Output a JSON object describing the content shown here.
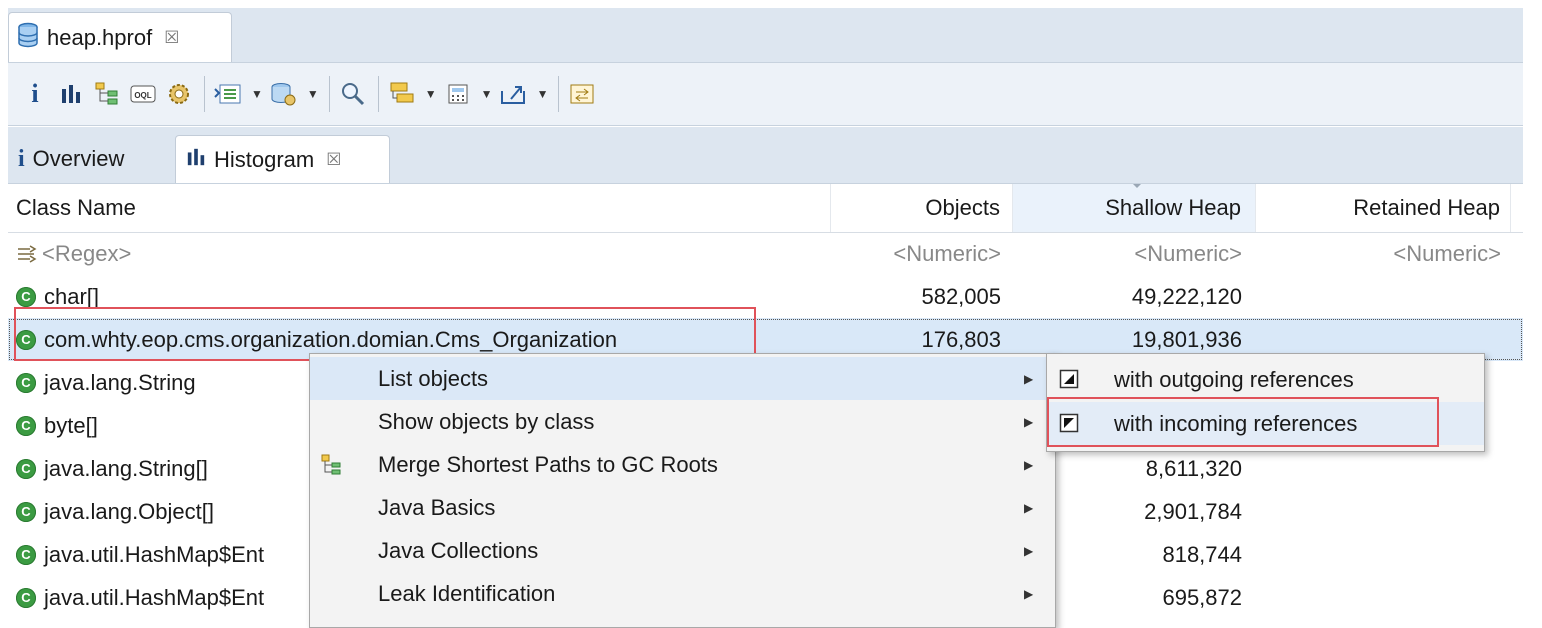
{
  "editor": {
    "tab": {
      "label": "heap.hprof",
      "close": "☒",
      "icon": "database-icon"
    }
  },
  "toolbar": {
    "buttons": [
      {
        "name": "overview-info-icon",
        "glyph": "i"
      },
      {
        "name": "histogram-icon"
      },
      {
        "name": "dominator-tree-icon"
      },
      {
        "name": "oql-icon",
        "text": "OQL"
      },
      {
        "name": "gear-icon"
      },
      {
        "name": "heap-dump-overview-icon",
        "dropdown": true
      },
      {
        "name": "query-browser-icon",
        "dropdown": true
      },
      {
        "name": "search-icon"
      },
      {
        "name": "group-by-icon",
        "dropdown": true
      },
      {
        "name": "calculator-icon",
        "dropdown": true
      },
      {
        "name": "export-icon",
        "dropdown": true
      },
      {
        "name": "compare-icon"
      }
    ]
  },
  "views": {
    "tabs": [
      {
        "label": "Overview",
        "icon": "info-icon",
        "active": false
      },
      {
        "label": "Histogram",
        "icon": "histogram-icon",
        "active": true,
        "close": "☒"
      }
    ]
  },
  "table": {
    "columns": [
      "Class Name",
      "Objects",
      "Shallow Heap",
      "Retained Heap"
    ],
    "sorted_column": "Shallow Heap",
    "filters": [
      "<Regex>",
      "<Numeric>",
      "<Numeric>",
      "<Numeric>"
    ],
    "rows": [
      {
        "name": "char[]",
        "objects": "582,005",
        "shallow": "49,222,120",
        "retained": ""
      },
      {
        "name": "com.whty.eop.cms.organization.domian.Cms_Organization",
        "objects": "176,803",
        "shallow": "19,801,936",
        "retained": "",
        "selected": true
      },
      {
        "name": "java.lang.String",
        "objects": "",
        "shallow": "",
        "retained": ""
      },
      {
        "name": "byte[]",
        "objects": "",
        "shallow": "",
        "retained": ""
      },
      {
        "name": "java.lang.String[]",
        "objects": "",
        "shallow": "8,611,320",
        "retained": ""
      },
      {
        "name": "java.lang.Object[]",
        "objects": "",
        "shallow": "2,901,784",
        "retained": ""
      },
      {
        "name": "java.util.HashMap$Ent",
        "objects": "",
        "shallow": "818,744",
        "retained": ""
      },
      {
        "name": "java.util.HashMap$Ent",
        "objects": "",
        "shallow": "695,872",
        "retained": ""
      }
    ]
  },
  "context_menu": {
    "items": [
      {
        "label": "List objects",
        "icon": "",
        "submenu": true,
        "hover": true
      },
      {
        "label": "Show objects by class",
        "icon": "",
        "submenu": true
      },
      {
        "label": "Merge Shortest Paths to GC Roots",
        "icon": "paths-icon",
        "submenu": true
      },
      {
        "label": "Java Basics",
        "icon": "",
        "submenu": true
      },
      {
        "label": "Java Collections",
        "icon": "",
        "submenu": true
      },
      {
        "label": "Leak Identification",
        "icon": "",
        "submenu": true
      }
    ]
  },
  "submenu": {
    "items": [
      {
        "label": "with outgoing references",
        "icon": "outgoing-references-icon"
      },
      {
        "label": "with incoming references",
        "icon": "incoming-references-icon",
        "hover": true
      }
    ]
  },
  "colors": {
    "class_icon": "#3b9b42",
    "highlight_box": "#e0525a",
    "selection": "#d9e8f8",
    "toolbar_bg": "#edf2f8",
    "tabbar_bg": "#dde6f0"
  }
}
